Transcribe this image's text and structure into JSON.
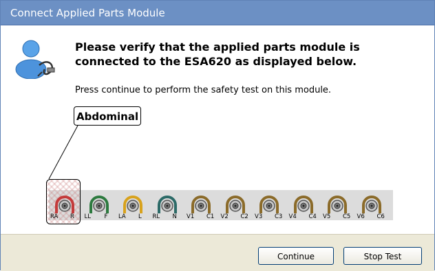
{
  "dialog": {
    "title": "Connect Applied Parts Module"
  },
  "content": {
    "heading": "Please verify that the applied parts module is connected to the ESA620 as displayed below.",
    "instruction": "Press continue to perform the safety test on this module.",
    "module_label": "Abdominal",
    "icons": {
      "user": "user-with-cable-icon"
    }
  },
  "connectors": [
    {
      "label": "RA",
      "alt": "R",
      "color": "#c43a3a"
    },
    {
      "label": "LL",
      "alt": "F",
      "color": "#2d7a3f"
    },
    {
      "label": "LA",
      "alt": "L",
      "color": "#d8a21c"
    },
    {
      "label": "RL",
      "alt": "N",
      "color": "#2c6a67"
    },
    {
      "label": "V1",
      "alt": "C1",
      "color": "#8b6b2a"
    },
    {
      "label": "V2",
      "alt": "C2",
      "color": "#8b6b2a"
    },
    {
      "label": "V3",
      "alt": "C3",
      "color": "#8b6b2a"
    },
    {
      "label": "V4",
      "alt": "C4",
      "color": "#8b6b2a"
    },
    {
      "label": "V5",
      "alt": "C5",
      "color": "#8b6b2a"
    },
    {
      "label": "V6",
      "alt": "C6",
      "color": "#8b6b2a"
    }
  ],
  "footer": {
    "continue_label": "Continue",
    "stop_label": "Stop Test"
  }
}
